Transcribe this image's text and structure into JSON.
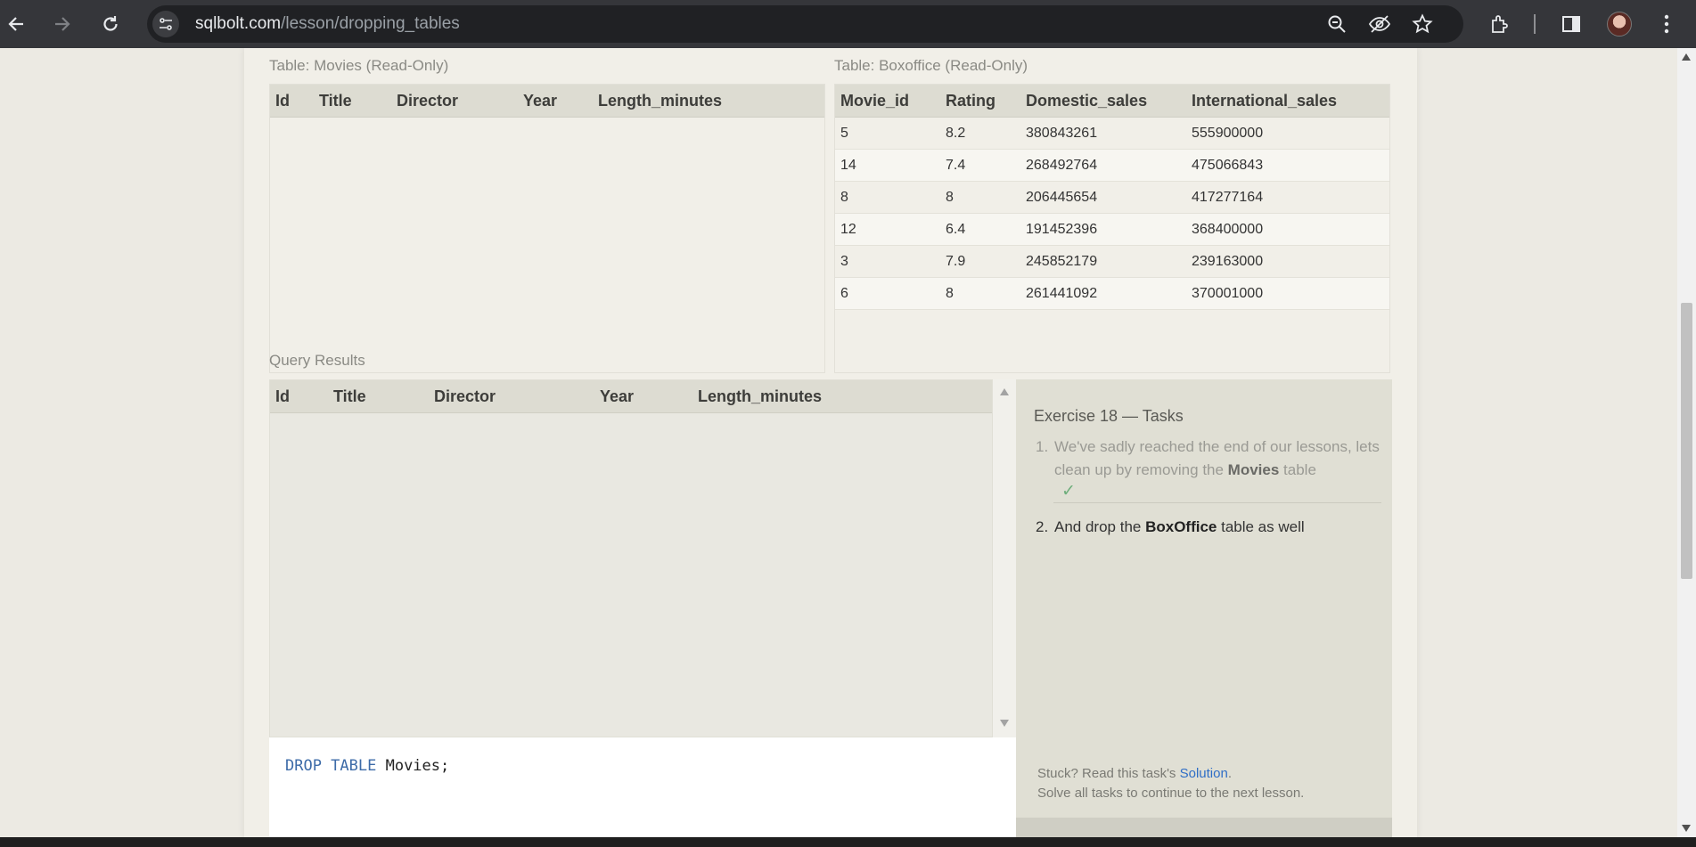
{
  "browser": {
    "url_domain": "sqlbolt.com",
    "url_path": "/lesson/dropping_tables"
  },
  "movies_table": {
    "caption": "Table: Movies (Read-Only)",
    "columns": [
      "Id",
      "Title",
      "Director",
      "Year",
      "Length_minutes"
    ],
    "rows": []
  },
  "boxoffice_table": {
    "caption": "Table: Boxoffice (Read-Only)",
    "columns": [
      "Movie_id",
      "Rating",
      "Domestic_sales",
      "International_sales"
    ],
    "rows": [
      [
        "5",
        "8.2",
        "380843261",
        "555900000"
      ],
      [
        "14",
        "7.4",
        "268492764",
        "475066843"
      ],
      [
        "8",
        "8",
        "206445654",
        "417277164"
      ],
      [
        "12",
        "6.4",
        "191452396",
        "368400000"
      ],
      [
        "3",
        "7.9",
        "245852179",
        "239163000"
      ],
      [
        "6",
        "8",
        "261441092",
        "370001000"
      ]
    ]
  },
  "results": {
    "label": "Query Results",
    "columns": [
      "Id",
      "Title",
      "Director",
      "Year",
      "Length_minutes"
    ]
  },
  "editor": {
    "keyword": "DROP TABLE",
    "rest": " Movies;"
  },
  "tasks": {
    "title": "Exercise 18 — Tasks",
    "task1": {
      "num": "1.",
      "pre": "We've sadly reached the end of our lessons, lets clean up by removing the ",
      "bold": "Movies",
      "post": " table",
      "check": "✓"
    },
    "task2": {
      "num": "2.",
      "pre": "And drop the ",
      "bold": "BoxOffice",
      "post": " table as well"
    },
    "stuck_pre": "Stuck? Read this task's ",
    "solution_link": "Solution",
    "stuck_post": ".",
    "continue_note": "Solve all tasks to continue to the next lesson."
  }
}
